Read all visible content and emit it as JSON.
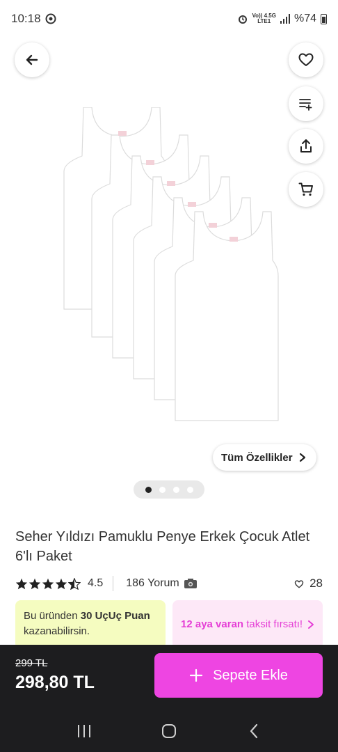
{
  "status": {
    "time": "10:18",
    "network_top": "Vo)) 4.5G",
    "network_bottom": "LTE1",
    "battery": "%74"
  },
  "product": {
    "title": "Seher Yıldızı Pamuklu Penye Erkek Çocuk Atlet 6'lı Paket",
    "rating": "4.5",
    "reviews": "186 Yorum",
    "favorites": "28",
    "all_features": "Tüm Özellikler",
    "image_count": 4,
    "active_image": 1
  },
  "promos": {
    "points_prefix": "Bu üründen ",
    "points_bold": "30 UçUç Puan",
    "points_suffix": " kazanabilirsin.",
    "installment_bold": "12 aya varan",
    "installment_suffix": " taksit fırsatı!"
  },
  "footer": {
    "old_price": "299 TL",
    "price": "298,80 TL",
    "add_to_cart": "Sepete Ekle"
  },
  "colors": {
    "accent": "#ee45e2",
    "promo_green": "#f5fcc0",
    "promo_pink": "#fde8f7",
    "bottom_bar": "#1d1d1f"
  }
}
